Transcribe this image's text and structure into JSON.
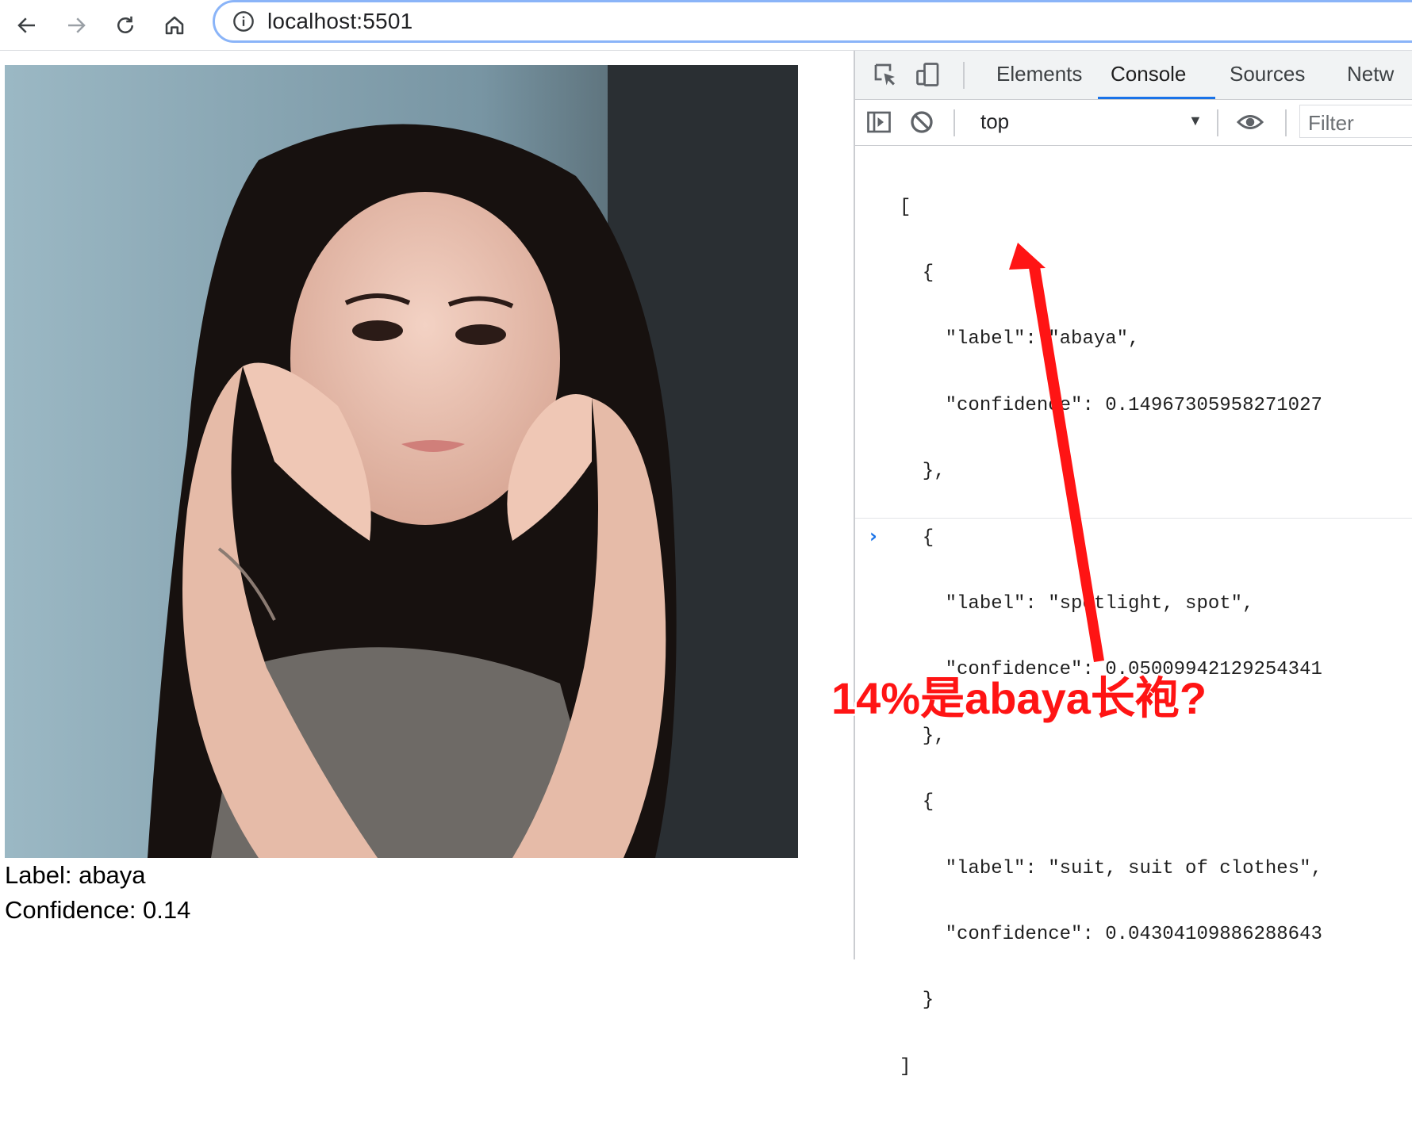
{
  "browser": {
    "url": "localhost:5501"
  },
  "page": {
    "result_label": "Label: abaya",
    "result_confidence": "Confidence: 0.14"
  },
  "devtools": {
    "tabs": [
      {
        "label": "Elements",
        "active": false
      },
      {
        "label": "Console",
        "active": true
      },
      {
        "label": "Sources",
        "active": false
      },
      {
        "label": "Netw",
        "active": false
      }
    ],
    "context": "top",
    "filter_placeholder": "Filter",
    "console_lines": [
      "[",
      "  {",
      "    \"label\": \"abaya\",",
      "    \"confidence\": 0.14967305958271027",
      "  },",
      "  {",
      "    \"label\": \"spotlight, spot\",",
      "    \"confidence\": 0.05009942129254341",
      "  },",
      "  {",
      "    \"label\": \"suit, suit of clothes\",",
      "    \"confidence\": 0.04304109886288643",
      "  }",
      "]"
    ],
    "prompt_symbol": "›"
  },
  "annotation": {
    "text": "14%是abaya长袍?",
    "color": "#ff1414"
  },
  "colors": {
    "accent": "#1a73e8",
    "omnibox_border": "#8ab4f8"
  },
  "icons": [
    "back-arrow-icon",
    "forward-arrow-icon",
    "reload-icon",
    "home-icon",
    "info-icon",
    "inspect-element-icon",
    "device-toolbar-icon",
    "sidebar-toggle-icon",
    "clear-console-icon",
    "eye-icon"
  ]
}
